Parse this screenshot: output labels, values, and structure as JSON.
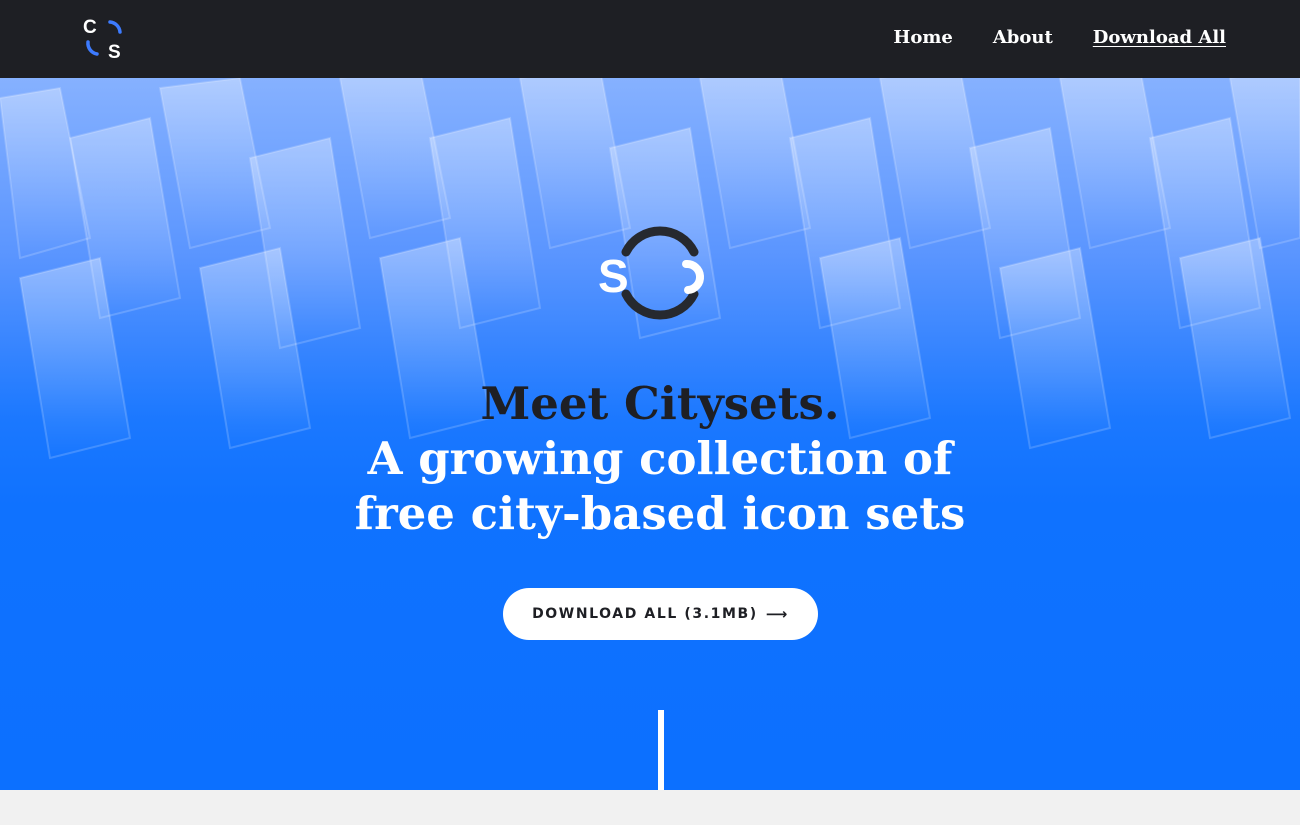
{
  "brand": {
    "logo_name": "citysets-logo",
    "logo_letters": "CS"
  },
  "nav": {
    "items": [
      {
        "label": "Home"
      },
      {
        "label": "About"
      },
      {
        "label": "Download All"
      }
    ]
  },
  "hero": {
    "headline_line1": "Meet Citysets.",
    "headline_line2": "A growing collection of",
    "headline_line3": "free city-based icon sets",
    "cta_label": "DOWNLOAD ALL (3.1MB)",
    "cta_icon": "arrow-right-icon"
  },
  "colors": {
    "topbar": "#1e1f24",
    "accent_blue": "#0c70ff",
    "logo_blue": "#3d7bff",
    "dark_text": "#1e1f24",
    "white": "#ffffff"
  }
}
